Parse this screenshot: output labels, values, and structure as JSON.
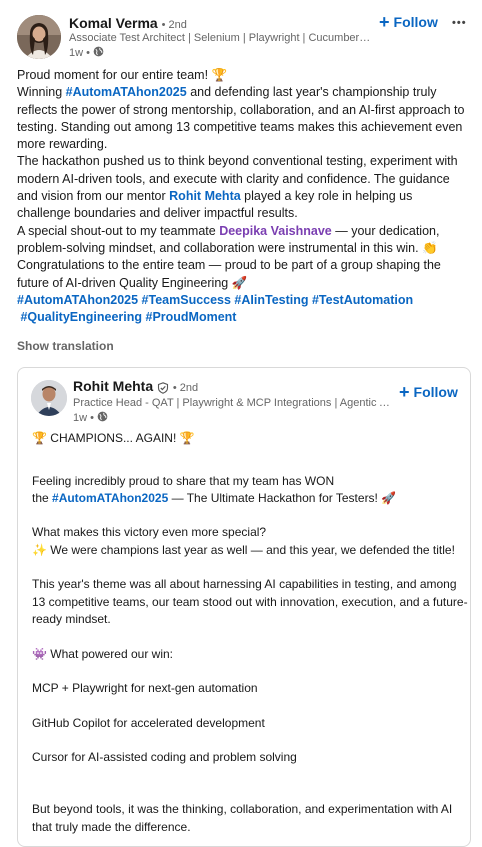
{
  "author": {
    "name": "Komal Verma",
    "degree": "• 2nd",
    "headline": "Associate Test Architect | Selenium | Playwright | Cucumber | Rest Assured | API Testing",
    "time": "1w •",
    "follow_label": "Follow",
    "more_label": "•••"
  },
  "post": {
    "line1": "Proud moment for our entire team! 🏆",
    "p2_pre": "Winning ",
    "p2_tag": "#AutomATAhon2025",
    "p2_post": " and defending last year's championship truly reflects the power of strong mentorship, collaboration, and an AI-first approach to testing. Standing out among 13 competitive teams makes this achievement even more rewarding.",
    "p3_pre": "The hackathon pushed us to think beyond conventional testing, experiment with modern AI-driven tools, and execute with clarity and confidence. The guidance and vision from our mentor ",
    "p3_mention": "Rohit Mehta",
    "p3_post": " played a key role in helping us challenge boundaries and deliver impactful results.",
    "p4_pre": "A special shout-out to my teammate ",
    "p4_mention": "Deepika Vaishnave",
    "p4_post": " — your dedication, problem-solving mindset, and collaboration were instrumental in this win. 👏",
    "p5": "Congratulations to the entire team — proud to be part of a group shaping the future of AI-driven Quality Engineering 🚀",
    "tags_line1": "#AutomATAhon2025 #TeamSuccess #AIinTesting #TestAutomation",
    "tags_line2": " #QualityEngineering #ProudMoment",
    "show_translation": "Show translation"
  },
  "quoted": {
    "name": "Rohit Mehta",
    "degree": "• 2nd",
    "headline": "Practice Head - QAT | Playwright & MCP Integrations | Agentic AI in Testing | Quality Engineering",
    "time": "1w •",
    "follow_label": "Follow",
    "l1": "🏆 CHAMPIONS... AGAIN! 🏆",
    "l2a": "Feeling incredibly proud to share that my team has WON",
    "l2b_pre": "the ",
    "l2b_tag": "#AutomATAhon2025",
    "l2b_post": " — The Ultimate Hackathon for Testers! 🚀",
    "l3a": "What makes this victory even more special?",
    "l3b": "✨ We were champions last year as well — and this year, we defended the title!",
    "l4": "This year's theme was all about harnessing AI capabilities in testing, and among 13 competitive teams, our team stood out with innovation, execution, and a future-ready mindset.",
    "l5": "👾 What powered our win:",
    "l6": "MCP + Playwright for next-gen automation",
    "l7": "GitHub Copilot for accelerated development",
    "l8": "Cursor for AI-assisted coding and problem solving",
    "l9": "But beyond tools, it was the thinking, collaboration, and experimentation with AI that truly made the difference."
  },
  "colors": {
    "link": "#0a66c2",
    "mention_purple": "#7a3eb1"
  }
}
